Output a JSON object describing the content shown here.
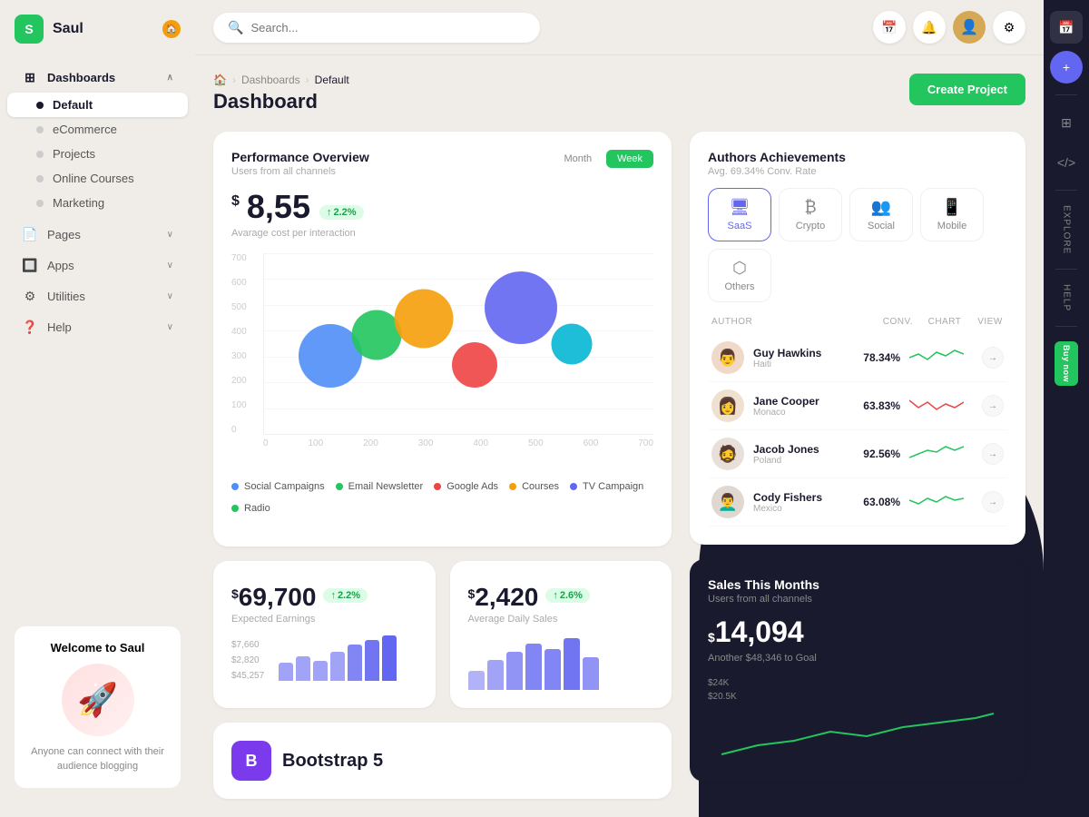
{
  "app": {
    "name": "Saul",
    "logo_letter": "S"
  },
  "header": {
    "search_placeholder": "Search...",
    "create_button": "Create Project"
  },
  "breadcrumb": {
    "home": "🏠",
    "dashboards": "Dashboards",
    "current": "Default"
  },
  "page": {
    "title": "Dashboard"
  },
  "sidebar": {
    "items": [
      {
        "label": "Dashboards",
        "icon": "⊞",
        "expandable": true
      },
      {
        "label": "Default",
        "active": true
      },
      {
        "label": "eCommerce"
      },
      {
        "label": "Projects"
      },
      {
        "label": "Online Courses"
      },
      {
        "label": "Marketing"
      },
      {
        "label": "Pages",
        "icon": "📄",
        "expandable": true
      },
      {
        "label": "Apps",
        "icon": "🔲",
        "expandable": true
      },
      {
        "label": "Utilities",
        "icon": "⚙",
        "expandable": true
      },
      {
        "label": "Help",
        "icon": "❓",
        "expandable": true
      }
    ],
    "welcome": {
      "title": "Welcome to Saul",
      "description": "Anyone can connect with their audience blogging"
    }
  },
  "performance": {
    "title": "Performance Overview",
    "subtitle": "Users from all channels",
    "value": "8,55",
    "currency": "$",
    "badge": "2.2%",
    "label": "Avarage cost per interaction",
    "time_month": "Month",
    "time_week": "Week",
    "chart": {
      "y_labels": [
        "700",
        "600",
        "500",
        "400",
        "300",
        "200",
        "100",
        "0"
      ],
      "x_labels": [
        "0",
        "100",
        "200",
        "300",
        "400",
        "500",
        "600",
        "700"
      ],
      "bubbles": [
        {
          "x": 17,
          "y": 57,
          "size": 70,
          "color": "#4f8ef7"
        },
        {
          "x": 29,
          "y": 52,
          "size": 55,
          "color": "#22c55e"
        },
        {
          "x": 41,
          "y": 43,
          "size": 65,
          "color": "#f59e0b"
        },
        {
          "x": 54,
          "y": 42,
          "size": 50,
          "color": "#ef4444"
        },
        {
          "x": 65,
          "y": 55,
          "size": 80,
          "color": "#6366f1"
        },
        {
          "x": 78,
          "y": 55,
          "size": 45,
          "color": "#06b6d4"
        }
      ]
    },
    "legend": [
      {
        "label": "Social Campaigns",
        "color": "#4f8ef7"
      },
      {
        "label": "Email Newsletter",
        "color": "#22c55e"
      },
      {
        "label": "Google Ads",
        "color": "#ef4444"
      },
      {
        "label": "Courses",
        "color": "#f59e0b"
      },
      {
        "label": "TV Campaign",
        "color": "#6366f1"
      },
      {
        "label": "Radio",
        "color": "#22c55e"
      }
    ]
  },
  "authors": {
    "title": "Authors Achievements",
    "subtitle": "Avg. 69.34% Conv. Rate",
    "tabs": [
      {
        "label": "SaaS",
        "icon": "🖥",
        "active": true
      },
      {
        "label": "Crypto",
        "icon": "₿"
      },
      {
        "label": "Social",
        "icon": "👥"
      },
      {
        "label": "Mobile",
        "icon": "📱"
      },
      {
        "label": "Others",
        "icon": "⬡"
      }
    ],
    "table_headers": {
      "author": "AUTHOR",
      "conv": "CONV.",
      "chart": "CHART",
      "view": "VIEW"
    },
    "rows": [
      {
        "name": "Guy Hawkins",
        "location": "Haiti",
        "conv": "78.34%",
        "sparkline_color": "#22c55e",
        "avatar": "👨"
      },
      {
        "name": "Jane Cooper",
        "location": "Monaco",
        "conv": "63.83%",
        "sparkline_color": "#ef4444",
        "avatar": "👩"
      },
      {
        "name": "Jacob Jones",
        "location": "Poland",
        "conv": "92.56%",
        "sparkline_color": "#22c55e",
        "avatar": "🧔"
      },
      {
        "name": "Cody Fishers",
        "location": "Mexico",
        "conv": "63.08%",
        "sparkline_color": "#22c55e",
        "avatar": "👨‍🦱"
      }
    ]
  },
  "stats": [
    {
      "currency": "$",
      "value": "69,700",
      "badge": "2.2%",
      "label": "Expected Earnings",
      "bars": [
        40,
        55,
        45,
        65,
        50,
        70,
        60
      ],
      "side_values": [
        "$7,660",
        "$2,820",
        "$45,257"
      ]
    },
    {
      "currency": "$",
      "value": "2,420",
      "badge": "2.6%",
      "label": "Average Daily Sales",
      "bars": [
        30,
        50,
        65,
        80,
        70,
        90,
        55
      ]
    }
  ],
  "sales": {
    "title": "Sales This Months",
    "subtitle": "Users from all channels",
    "currency": "$",
    "value": "14,094",
    "goal_text": "Another $48,346 to Goal",
    "y_labels": [
      "$24K",
      "$20.5K"
    ]
  },
  "bootstrap_badge": {
    "letter": "B",
    "text": "Bootstrap 5"
  },
  "right_sidebar": {
    "icons": [
      "📅",
      "+",
      "⚙",
      "</>"
    ]
  }
}
